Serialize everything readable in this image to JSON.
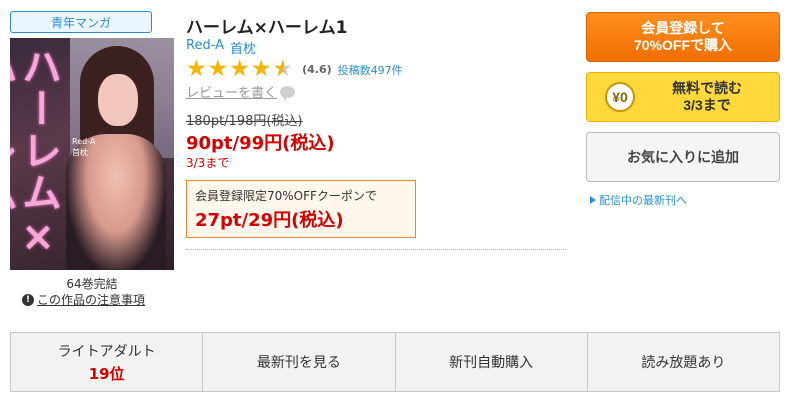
{
  "genre": "青年マンガ",
  "cover": {
    "vertical_title": "ハーレム×ハーレム",
    "credit_author": "Red-A",
    "credit_artist": "首枕"
  },
  "volumes": "64巻完結",
  "notice_link": "この作品の注意事項",
  "title": "ハーレム×ハーレム1",
  "authors": [
    "Red-A",
    "首枕"
  ],
  "rating": {
    "stars": 4.6,
    "value_label": "(4.6)",
    "review_count_label": "投稿数497件"
  },
  "write_review": "レビューを書く",
  "price": {
    "original": "180pt/198円(税込)",
    "sale": "90pt/99円(税込)",
    "sale_until": "3/3まで"
  },
  "coupon": {
    "label": "会員登録限定70%OFFクーポンで",
    "price": "27pt/29円(税込)"
  },
  "buttons": {
    "register_line1": "会員登録して",
    "register_line2": "70%OFFで購入",
    "free_icon": "¥0",
    "free_line1": "無料で読む",
    "free_line2": "3/3まで",
    "favorite": "お気に入りに追加"
  },
  "latest_link": "配信中の最新刊へ",
  "bottom_bar": {
    "ranking_category": "ライトアダルト",
    "ranking_rank": "19位",
    "latest": "最新刊を見る",
    "auto_purchase": "新刊自動購入",
    "unlimited": "読み放題あり"
  },
  "colors": {
    "accent_blue": "#2a8fd2",
    "price_red": "#d60000",
    "register_orange": "#f07800",
    "free_yellow": "#ffd93b",
    "star": "#f5b400"
  }
}
